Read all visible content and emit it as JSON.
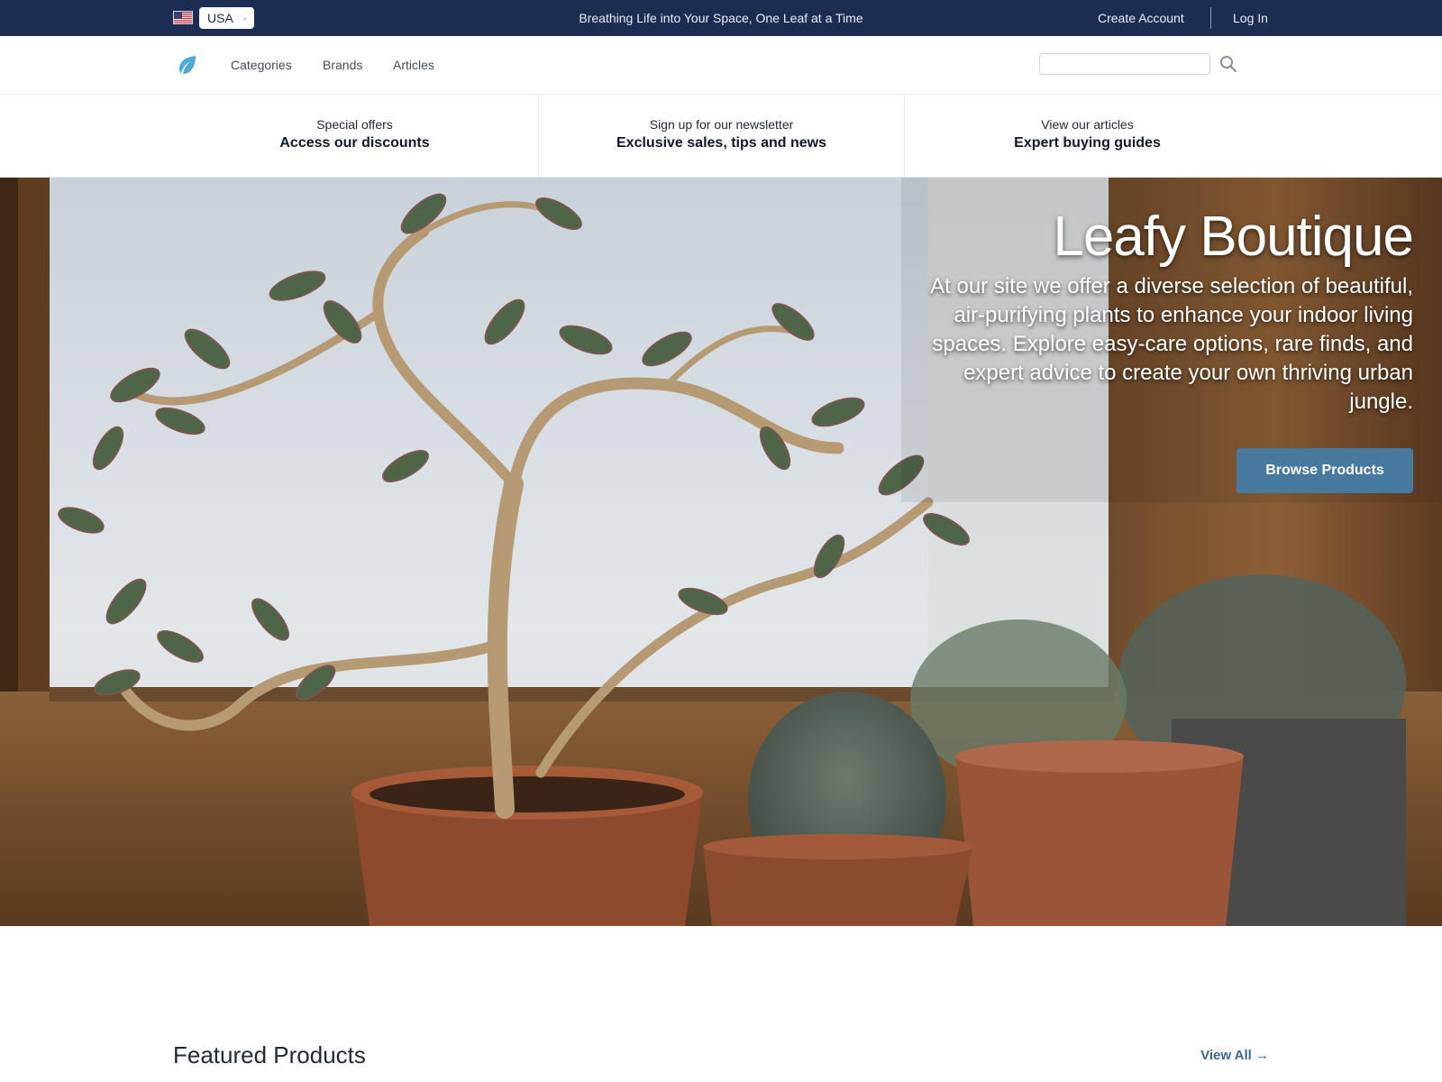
{
  "topbar": {
    "country": "USA",
    "tagline": "Breathing Life into Your Space, One Leaf at a Time",
    "create_account": "Create Account",
    "log_in": "Log In"
  },
  "nav": {
    "links": [
      "Categories",
      "Brands",
      "Articles"
    ],
    "search_placeholder": ""
  },
  "promos": [
    {
      "eyebrow": "Special offers",
      "headline": "Access our discounts"
    },
    {
      "eyebrow": "Sign up for our newsletter",
      "headline": "Exclusive sales, tips and news"
    },
    {
      "eyebrow": "View our articles",
      "headline": "Expert buying guides"
    }
  ],
  "hero": {
    "title": "Leafy Boutique",
    "copy": "At our site we offer a diverse selection of beautiful, air-purifying plants to enhance your indoor living spaces. Explore easy-care options, rare finds, and expert advice to create your own thriving urban jungle.",
    "cta": "Browse Products"
  },
  "featured": {
    "title": "Featured Products",
    "view_all": "View All →"
  },
  "colors": {
    "topbar_bg": "#1b2e52",
    "accent": "#47789e",
    "link": "#3d6a92",
    "logo": "#4fa8d8"
  }
}
